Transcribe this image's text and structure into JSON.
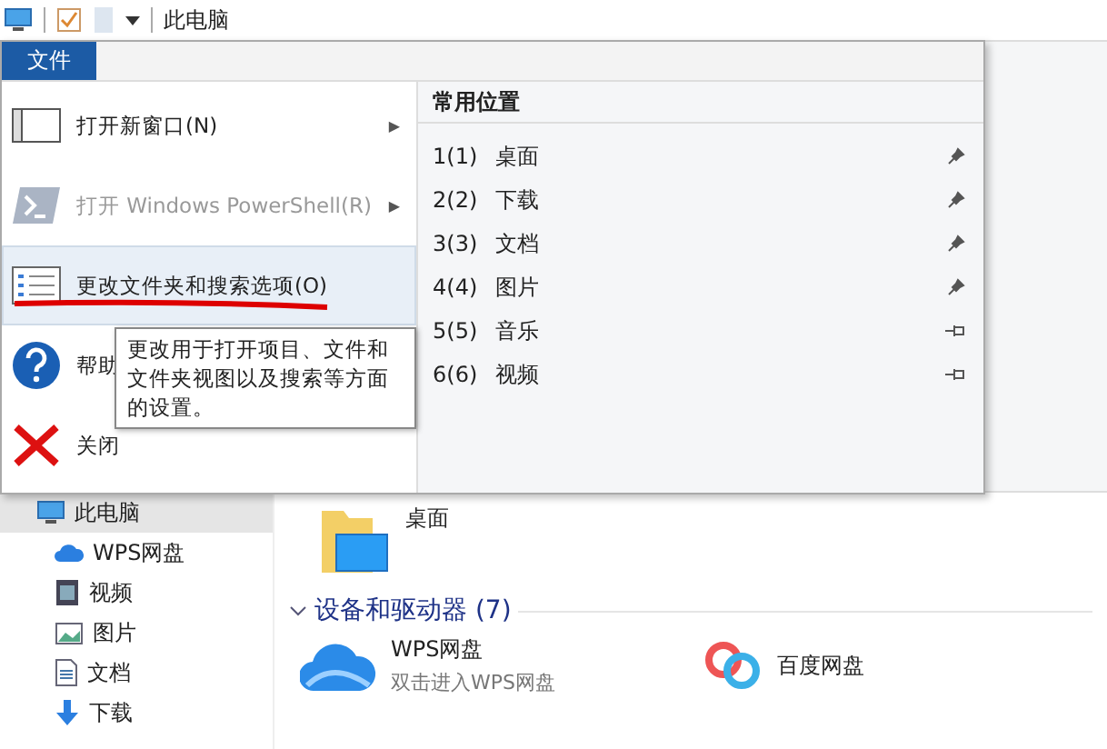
{
  "title_bar": {
    "title": "此电脑"
  },
  "file_menu": {
    "tab": {
      "label": "文件",
      "selected": true
    },
    "items": [
      {
        "kind": "window",
        "label": "打开新窗口(N)",
        "arrow": "▶",
        "disabled": false,
        "selected": false
      },
      {
        "kind": "shell",
        "label": "打开 Windows PowerShell(R)",
        "arrow": "▶",
        "disabled": true,
        "selected": false
      },
      {
        "kind": "options",
        "label": "更改文件夹和搜索选项(O)",
        "disabled": false,
        "selected": true
      },
      {
        "kind": "help",
        "label": "帮助",
        "disabled": false,
        "selected": false
      },
      {
        "kind": "close",
        "label": "关闭",
        "disabled": false,
        "selected": false
      }
    ],
    "tooltip": "更改用于打开项目、文件和文件夹视图以及搜索等方面的设置。",
    "places_title": "常用位置",
    "places": [
      {
        "number": "1(1)",
        "name": "桌面",
        "pinned": true
      },
      {
        "number": "2(2)",
        "name": "下载",
        "pinned": true
      },
      {
        "number": "3(3)",
        "name": "文档",
        "pinned": true
      },
      {
        "number": "4(4)",
        "name": "图片",
        "pinned": true
      },
      {
        "number": "5(5)",
        "name": "音乐",
        "pinned": false
      },
      {
        "number": "6(6)",
        "name": "视频",
        "pinned": false
      }
    ]
  },
  "sidebar": {
    "items": [
      {
        "kind": "pc",
        "label": "此电脑",
        "selected": true
      },
      {
        "kind": "cloud",
        "label": "WPS网盘",
        "selected": false
      },
      {
        "kind": "video",
        "label": "视频",
        "selected": false
      },
      {
        "kind": "image",
        "label": "图片",
        "selected": false
      },
      {
        "kind": "doc",
        "label": "文档",
        "selected": false
      },
      {
        "kind": "download",
        "label": "下载",
        "selected": false
      }
    ]
  },
  "content": {
    "folders": [
      {
        "name": "桌面"
      }
    ],
    "section": {
      "title": "设备和驱动器 (7)",
      "expanded": true
    },
    "drives": [
      {
        "kind": "wps",
        "name": "WPS网盘",
        "subtitle": "双击进入WPS网盘"
      },
      {
        "kind": "baidu",
        "name": "百度网盘"
      }
    ]
  }
}
